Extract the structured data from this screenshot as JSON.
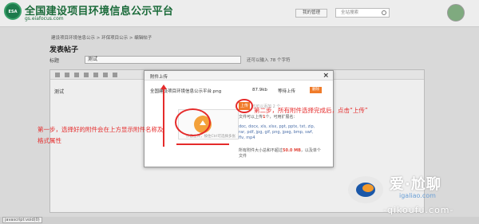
{
  "header": {
    "logo_text": "ESA",
    "title": "全国建设项目环境信息公示平台",
    "url": "gs.eiafocus.com",
    "nav_button": "我的管理",
    "search_placeholder": "全站搜索"
  },
  "breadcrumb": "建设项目环境信息公示 > 环保项目公示 > 编辑帖子",
  "page_title": "发表帖子",
  "subject": {
    "label": "标题",
    "value": "测试",
    "hint": "还可以输入 78 个字符"
  },
  "editor": {
    "content": "测试"
  },
  "status_bar": {
    "text": "javascript:void(0)"
  },
  "modal": {
    "title": "附件上传",
    "close": "×",
    "file": {
      "name": "全国建设项目环境信息公示平台.png",
      "size": "87.9kb",
      "status": "等待上传",
      "delete_label": "删除"
    },
    "drop_hint": "点击上传，按住Ctrl可选择多张",
    "upload_button": "上传",
    "upload_tip": "还可以添加 2 个",
    "info_prefix": "文件可以上传",
    "info_num": "1",
    "info_suffix": "个，可用扩展名：",
    "types": "doc, docx, xls, xlsx, ppt, pptx, txt, zip, rar, pdf, jpg, gif, png, jpeg, bmp, swf, flv, mp4",
    "size_prefix": "所有附件大小总和不超过",
    "size_num": "50.0 MB",
    "size_suffix": "，以及单个文件"
  },
  "annotations": {
    "step1": "第一步，选择好的附件会在上方显示附件名称及格式属性",
    "step2": "第二步，所有附件选择完成后，点击“上传”"
  },
  "watermark": {
    "title": "爱·尬聊",
    "url": "igaliao.com",
    "sub": "-qikoufu.com-"
  },
  "colors": {
    "accent": "#f07b29",
    "annotation": "#e52b2b",
    "brand": "#1b6b3a"
  }
}
